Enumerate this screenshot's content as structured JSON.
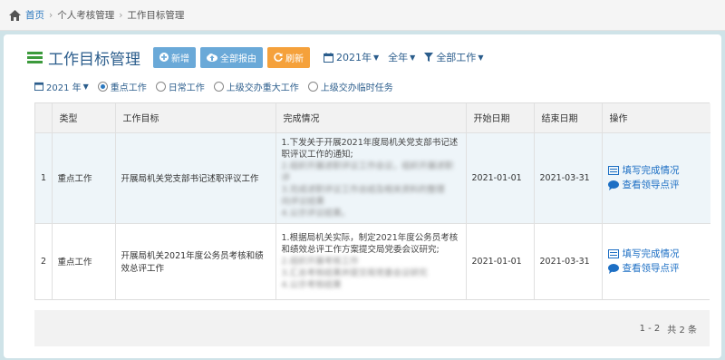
{
  "breadcrumb": {
    "home": "首页",
    "level1": "个人考核管理",
    "level2": "工作目标管理"
  },
  "header": {
    "title": "工作目标管理",
    "btn_add": "新增",
    "btn_export": "全部报由",
    "btn_refresh": "刷新",
    "year_filter": "2021年",
    "period_filter": "全年",
    "type_filter": "全部工作"
  },
  "subfilter": {
    "year": "2021 年",
    "options": [
      "重点工作",
      "日常工作",
      "上级交办重大工作",
      "上级交办临时任务"
    ],
    "selected_index": 0
  },
  "table": {
    "columns": [
      "类型",
      "工作目标",
      "完成情况",
      "开始日期",
      "结束日期",
      "操作"
    ],
    "rows": [
      {
        "index": "1",
        "type": "重点工作",
        "goal": "开展局机关党支部书记述职评议工作",
        "progress_lines": [
          "1.下发关于开展2021年度局机关党支部书记述",
          "职评议工作的通知;"
        ],
        "progress_blurred": [
          "2.组织开展述职评议工作会议，组织开展述职评",
          "3.完成述职评议工作总结及相关资料的整理",
          "向评议结果",
          "4.公示评议结果。"
        ],
        "start": "2021-01-01",
        "end": "2021-03-31",
        "action1": "填写完成情况",
        "action2": "查看领导点评"
      },
      {
        "index": "2",
        "type": "重点工作",
        "goal": "开展局机关2021年度公务员考核和绩效总评工作",
        "progress_lines": [
          "1.根据局机关实际，制定2021年度公务员考核",
          "和绩效总评工作方案提交局党委会议研究;"
        ],
        "progress_blurred": [
          "2.组织开展考核工作",
          "3.汇总考核结果并提交局党委会议研究",
          "4.公示考核结果"
        ],
        "start": "2021-01-01",
        "end": "2021-03-31",
        "action1": "填写完成情况",
        "action2": "查看领导点评"
      }
    ]
  },
  "pager": {
    "range": "1 - 2",
    "total": "共 2 条"
  },
  "colors": {
    "accent": "#2a78bf",
    "title": "#2b5d8c",
    "button_blue": "#6aa9d8",
    "button_orange": "#f5a13b"
  }
}
